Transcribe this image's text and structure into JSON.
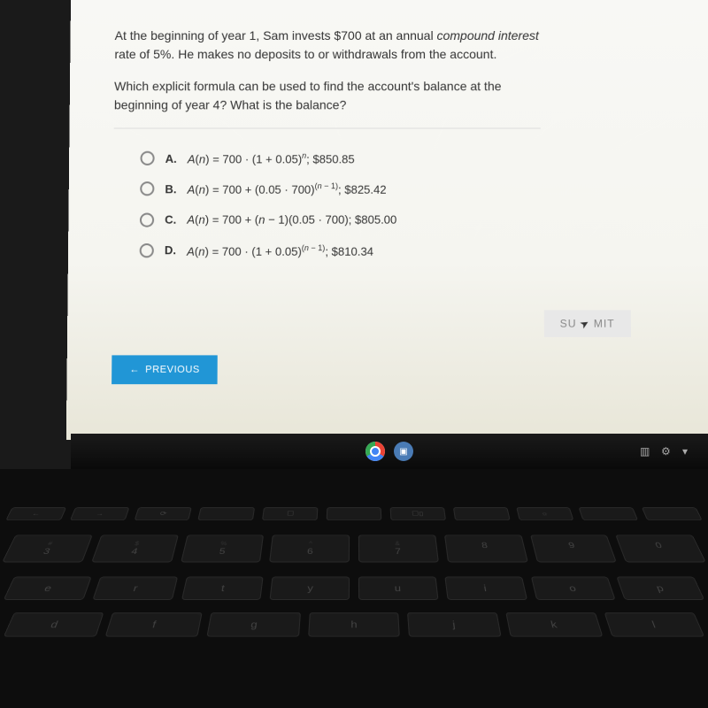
{
  "question": {
    "line1_prefix": "At the beginning of year 1, Sam invests $700 at an annual ",
    "line1_emphasis": "compound interest",
    "line1_suffix": "",
    "line2": "rate of 5%. He makes no deposits to or withdrawals from the account.",
    "sub1": "Which explicit formula can be used to find the account's balance at the",
    "sub2": "beginning of year 4? What is the balance?"
  },
  "options": [
    {
      "letter": "A.",
      "formula_prefix": "A(n) = 700 · (1 + 0.05)",
      "formula_sup": "n",
      "formula_suffix": "; $850.85"
    },
    {
      "letter": "B.",
      "formula_prefix": "A(n) = 700 + (0.05 · 700)",
      "formula_sup": "(n − 1)",
      "formula_suffix": "; $825.42"
    },
    {
      "letter": "C.",
      "formula_prefix": "A(n) = 700 + (n − 1)(0.05 · 700)",
      "formula_sup": "",
      "formula_suffix": "; $805.00"
    },
    {
      "letter": "D.",
      "formula_prefix": "A(n) = 700 · (1 + 0.05)",
      "formula_sup": "(n − 1)",
      "formula_suffix": "; $810.34"
    }
  ],
  "buttons": {
    "submit": "SUBMIT",
    "previous": "PREVIOUS"
  },
  "taskbar": {
    "chrome": "chrome-icon",
    "video": "video-icon"
  },
  "keyboard": {
    "fn_row": [
      "",
      "",
      "⟳",
      "",
      "☐",
      "",
      "☐▯",
      "",
      "☼",
      "",
      "",
      ""
    ],
    "num_row": [
      "#",
      "$",
      "%",
      "",
      "&",
      "",
      "",
      ""
    ],
    "num_row_sub": [
      "3",
      "4",
      "5",
      "6",
      "7",
      "8",
      "9",
      "0"
    ],
    "row1": [
      "e",
      "r",
      "t",
      "y",
      "u",
      "i",
      "o",
      "p"
    ],
    "row2": [
      "d",
      "f",
      "g",
      "h",
      "j",
      "k",
      "l"
    ],
    "row3": [
      "",
      "",
      "",
      "",
      "<"
    ]
  }
}
